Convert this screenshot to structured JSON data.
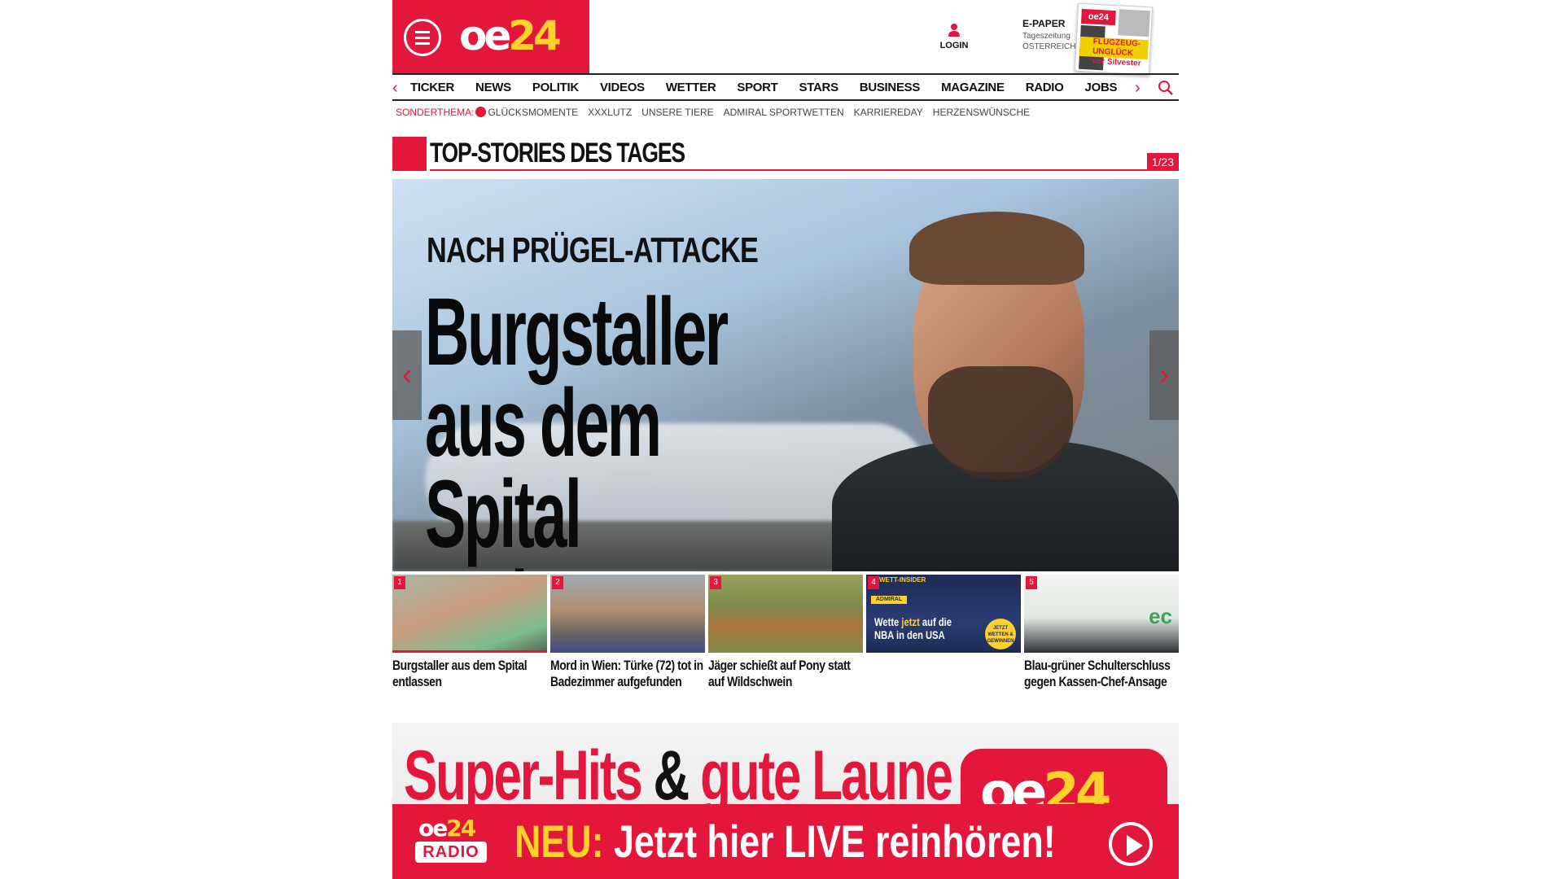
{
  "header": {
    "logo": "oe24",
    "login_label": "LOGIN",
    "epaper": {
      "title": "E-PAPER",
      "line1": "Tageszeitung",
      "line2": "ÖSTERREICH"
    },
    "cover_headline": "FLUGZEUG-UNGLÜCK vor Silvester"
  },
  "nav": {
    "items": [
      "TICKER",
      "NEWS",
      "POLITIK",
      "VIDEOS",
      "WETTER",
      "SPORT",
      "STARS",
      "BUSINESS",
      "MAGAZINE",
      "RADIO",
      "JOBS"
    ]
  },
  "subnav": {
    "label": "SONDERTHEMA:",
    "items": [
      "GLÜCKSMOMENTE",
      "XXXLUTZ",
      "UNSERE TIERE",
      "ADMIRAL SPORTWETTEN",
      "KARRIEREDAY",
      "HERZENSWÜNSCHE"
    ]
  },
  "section": {
    "title": "TOP-STORIES DES TAGES",
    "counter": "1/23"
  },
  "hero": {
    "kicker": "NACH PRÜGEL-ATTACKE",
    "headline": "Burgstaller aus dem Spital entlassen"
  },
  "thumbs": [
    {
      "num": "1",
      "caption": "Burgstaller aus dem Spital entlassen"
    },
    {
      "num": "2",
      "caption": "Mord in Wien: Türke (72) tot in Badezimmer aufgefunden"
    },
    {
      "num": "3",
      "caption": "Jäger schießt auf Pony statt auf Wildschwein"
    },
    {
      "num": "4",
      "caption": "",
      "ad_top": "WETT-INSIDER",
      "ad_brand": "ADMIRAL",
      "ad_line_a": "Wette ",
      "ad_line_b": "jetzt",
      "ad_line_c": " auf die",
      "ad_line_d": "NBA in den USA",
      "ad_badge": "JETZT WETTEN & GEWINNEN"
    },
    {
      "num": "5",
      "caption": "Blau-grüner Schulterschluss gegen Kassen-Chef-Ansage",
      "ad_text": "ec"
    }
  ],
  "banner": {
    "headline_a": "Super-Hits ",
    "headline_amp": "&",
    "headline_b": " gute Laune",
    "logo": "oe24",
    "radio_logo_top": "oe24",
    "radio_logo_bottom": "RADIO",
    "cta_new": "NEU:",
    "cta_text": " Jetzt hier LIVE reinhören!"
  },
  "colors": {
    "brand": "#e3163c",
    "accent": "#ffd12a"
  }
}
